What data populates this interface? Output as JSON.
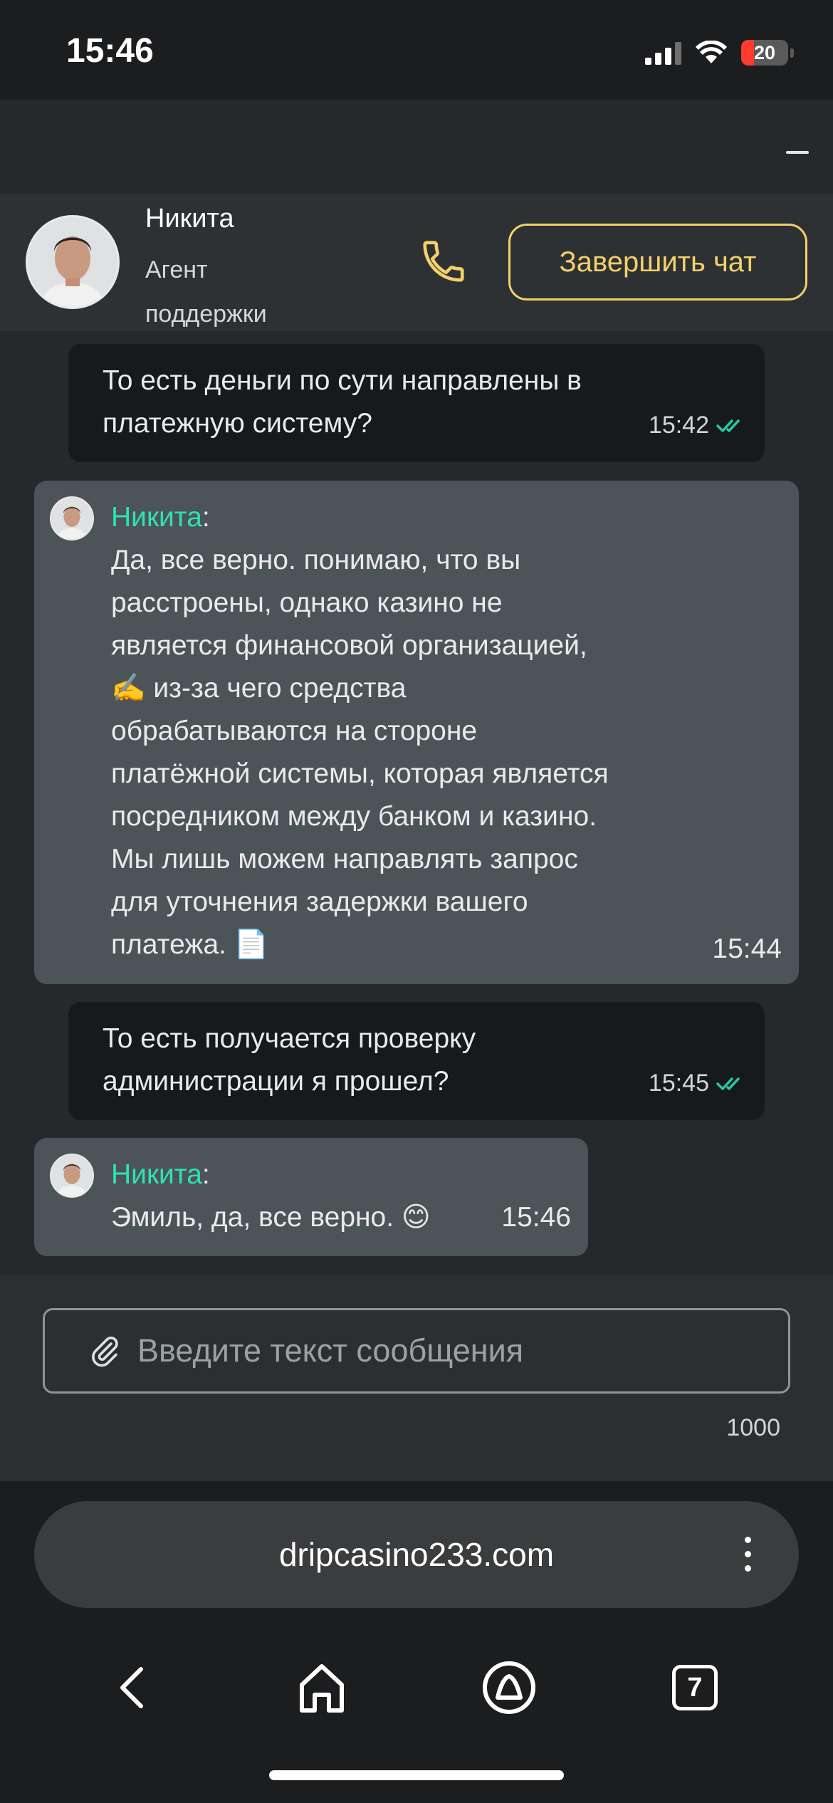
{
  "status_bar": {
    "time": "15:46",
    "battery": "20"
  },
  "agent": {
    "name": "Никита",
    "role": "Агент поддержки"
  },
  "header": {
    "end_chat_label": "Завершить чат"
  },
  "messages": [
    {
      "from": "user",
      "text": "То есть деньги по сути направлены в платежную систему?",
      "time": "15:42"
    },
    {
      "from": "agent",
      "sender": "Никита",
      "text": "Да, все верно. понимаю, что вы\nрасстроены, однако казино не\nявляется финансовой организацией,\n✍️ из-за чего средства\nобрабатываются на стороне\nплатёжной системы, которая является\nпосредником между банком и казино.\nМы лишь можем направлять запрос\nдля уточнения задержки вашего\nплатежа. 📄",
      "time": "15:44"
    },
    {
      "from": "user",
      "text": "То есть получается проверку администрации я прошел?",
      "time": "15:45"
    },
    {
      "from": "agent",
      "sender": "Никита",
      "text": "Эмиль, да, все верно. 😊",
      "time": "15:46"
    }
  ],
  "composer": {
    "placeholder": "Введите текст сообщения",
    "char_limit": "1000"
  },
  "browser": {
    "url": "dripcasino233.com",
    "tab_count": "7"
  },
  "colors": {
    "accent": "#f4d06a",
    "sender_name": "#2ee3ae",
    "read_check": "#2ec4a0"
  }
}
